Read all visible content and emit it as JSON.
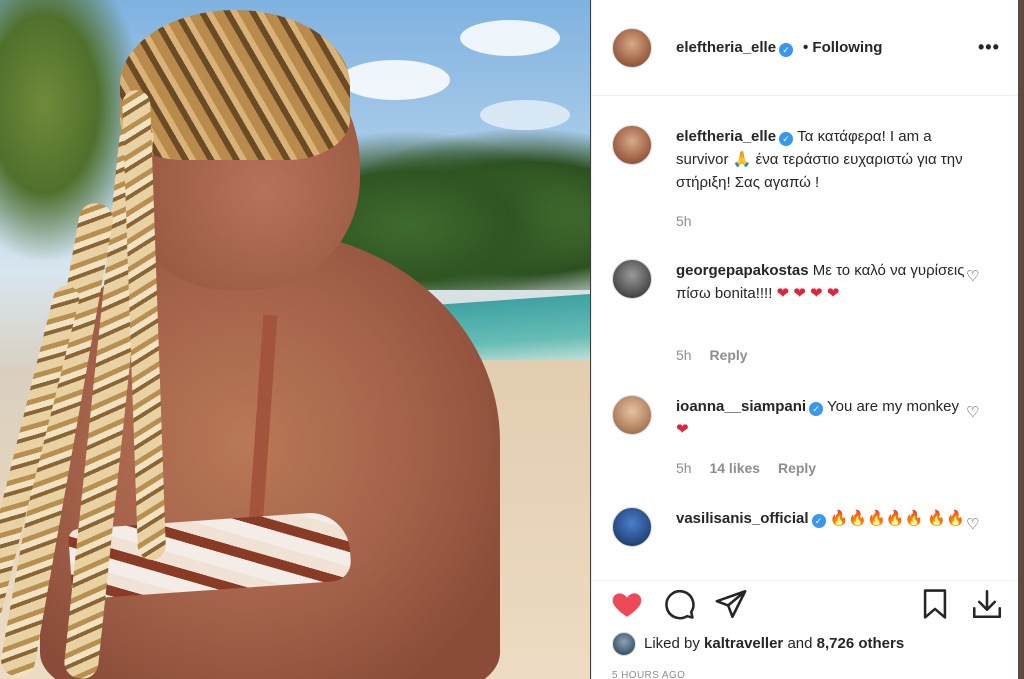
{
  "post": {
    "author": "eleftheria_elle",
    "follow_status": "• Following",
    "more_label": "•••"
  },
  "caption": {
    "username": "eleftheria_elle",
    "text": "Τα κατάφερα! I am a survivor 🙏 ένα τεράστιο ευχαριστώ για την στήριξη! Σας αγαπώ !",
    "time": "5h"
  },
  "comments": [
    {
      "username": "georgepapakostas",
      "verified": false,
      "text": "Με το καλό να γυρίσεις πίσω bonita!!!! ",
      "emoji": "❤ ❤ ❤ ❤",
      "time": "5h",
      "likes": "",
      "reply": "Reply"
    },
    {
      "username": "ioanna__siampani",
      "verified": true,
      "text": "You are my monkey ",
      "emoji": "❤",
      "time": "5h",
      "likes": "14 likes",
      "reply": "Reply"
    },
    {
      "username": "vasilisanis_official",
      "verified": true,
      "text": "",
      "emoji": "🔥🔥🔥🔥🔥 🔥🔥",
      "time": "",
      "likes": "",
      "reply": ""
    }
  ],
  "likes": {
    "prefix": "Liked by ",
    "user": "kaltraveller",
    "middle": " and ",
    "count": "8,726 others"
  },
  "footer_time": "5 HOURS AGO",
  "colors": {
    "verified": "#3897f0",
    "liked_heart": "#ed4956",
    "text": "#262626",
    "muted": "#8e8e8e"
  },
  "icons": [
    "heart-filled-icon",
    "comment-icon",
    "share-icon",
    "bookmark-icon",
    "download-icon",
    "verified-badge-icon",
    "more-icon"
  ]
}
